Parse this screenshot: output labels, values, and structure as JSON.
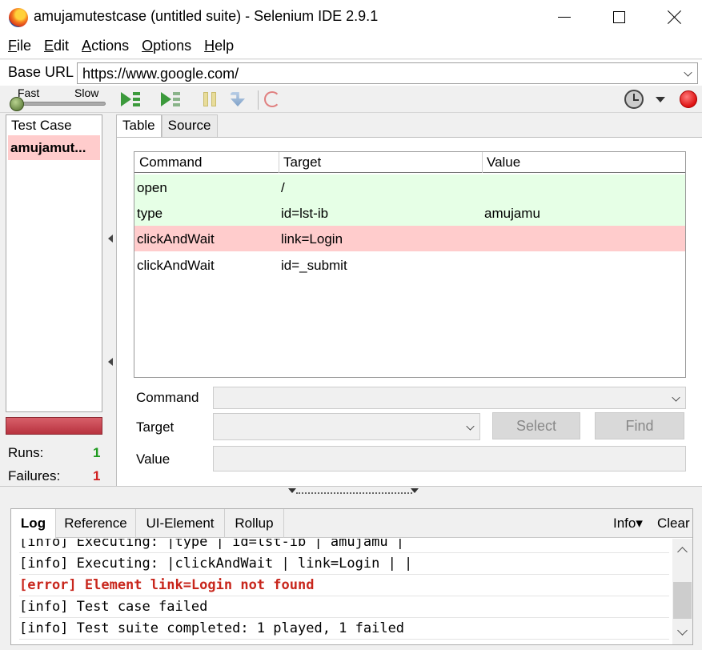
{
  "window": {
    "title": "amujamutestcase (untitled suite) - Selenium IDE 2.9.1"
  },
  "menu": [
    {
      "mnemonic": "F",
      "rest": "ile"
    },
    {
      "mnemonic": "E",
      "rest": "dit"
    },
    {
      "mnemonic": "A",
      "rest": "ctions"
    },
    {
      "mnemonic": "O",
      "rest": "ptions"
    },
    {
      "mnemonic": "H",
      "rest": "elp"
    }
  ],
  "base_url": {
    "label": "Base URL",
    "value": "https://www.google.com/"
  },
  "toolbar": {
    "speed_fast": "Fast",
    "speed_slow": "Slow",
    "speed_level": 0
  },
  "test_cases": {
    "header": "Test Case",
    "items": [
      "amujamut..."
    ],
    "runs_label": "Runs:",
    "runs": "1",
    "failures_label": "Failures:",
    "failures": "1",
    "status_color": "#c0394a"
  },
  "editor": {
    "tabs": [
      "Table",
      "Source"
    ],
    "columns": [
      "Command",
      "Target",
      "Value"
    ],
    "rows": [
      {
        "command": "open",
        "target": "/",
        "value": "",
        "status": "pass"
      },
      {
        "command": "type",
        "target": "id=lst-ib",
        "value": "amujamu",
        "status": "pass"
      },
      {
        "command": "clickAndWait",
        "target": "link=Login",
        "value": "",
        "status": "fail"
      },
      {
        "command": "clickAndWait",
        "target": "id=_submit",
        "value": "",
        "status": "none"
      }
    ],
    "command_label": "Command",
    "target_label": "Target",
    "value_label": "Value",
    "select_button": "Select",
    "find_button": "Find"
  },
  "log": {
    "tabs": [
      "Log",
      "Reference",
      "UI-Element",
      "Rollup"
    ],
    "info_button": "Info▾",
    "clear_button": "Clear",
    "lines": [
      {
        "text": "[info] Executing: |type | id=lst-ib | amujamu |",
        "level": "info"
      },
      {
        "text": "[info] Executing: |clickAndWait | link=Login | |",
        "level": "info"
      },
      {
        "text": "[error] Element link=Login not found",
        "level": "error"
      },
      {
        "text": "[info] Test case failed",
        "level": "info"
      },
      {
        "text": "[info] Test suite completed: 1 played, 1 failed",
        "level": "info"
      }
    ]
  },
  "colors": {
    "pass_row": "#e6ffe6",
    "fail_row": "#ffcccc",
    "error_text": "#c8261c",
    "runs_green": "#1e9a1e",
    "failures_red": "#d02020"
  }
}
